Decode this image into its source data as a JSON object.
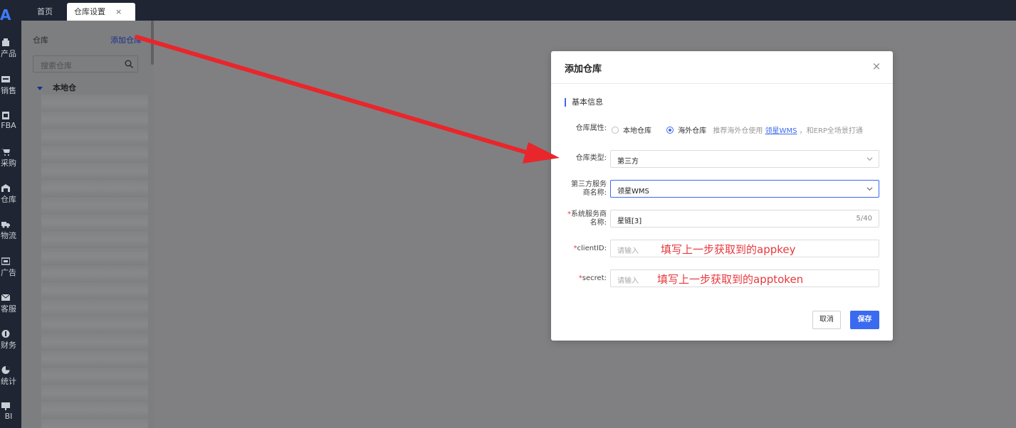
{
  "nav": {
    "logo": "A",
    "items": [
      {
        "label": "产品",
        "icon": "product-icon"
      },
      {
        "label": "销售",
        "icon": "sales-icon"
      },
      {
        "label": "FBA",
        "icon": "fba-icon"
      },
      {
        "label": "采购",
        "icon": "cart-icon"
      },
      {
        "label": "仓库",
        "icon": "warehouse-icon"
      },
      {
        "label": "物流",
        "icon": "truck-icon"
      },
      {
        "label": "广告",
        "icon": "ad-icon"
      },
      {
        "label": "客服",
        "icon": "mail-icon"
      },
      {
        "label": "财务",
        "icon": "finance-icon"
      },
      {
        "label": "统计",
        "icon": "pie-icon"
      },
      {
        "label": "BI",
        "icon": "bi-icon"
      }
    ]
  },
  "tabs": [
    {
      "label": "首页"
    },
    {
      "label": "仓库设置",
      "close": "×"
    }
  ],
  "warehouse_panel": {
    "title": "仓库",
    "add_link": "添加仓库",
    "search_placeholder": "搜索仓库",
    "tree_root": "本地仓"
  },
  "modal": {
    "title": "添加仓库",
    "close": "×",
    "section": "基本信息",
    "attr_label": "仓库属性:",
    "attr_options": [
      "本地仓库",
      "海外仓库"
    ],
    "attr_selected": "海外仓库",
    "hint_prefix": "推荐海外仓使用",
    "hint_link": "领星WMS",
    "hint_suffix": "，和ERP全场景打通",
    "type_label": "仓库类型:",
    "type_value": "第三方",
    "provider_label_line1": "第三方服务",
    "provider_label_line2": "商名称:",
    "provider_value": "领星WMS",
    "system_label_line1": "系统服务商",
    "system_label_line2": "名称:",
    "system_value": "星链[3]",
    "system_count": "5/40",
    "client_label": "clientID:",
    "client_placeholder": "请输入",
    "secret_label": "secret:",
    "secret_placeholder": "请输入",
    "cancel": "取消",
    "save": "保存"
  },
  "annotations": {
    "client": "填写上一步获取到的appkey",
    "secret": "填写上一步获取到的apptoken"
  },
  "colors": {
    "nav_bg": "#1f2532",
    "accent": "#3a6af0",
    "annotation": "#e8383d"
  }
}
